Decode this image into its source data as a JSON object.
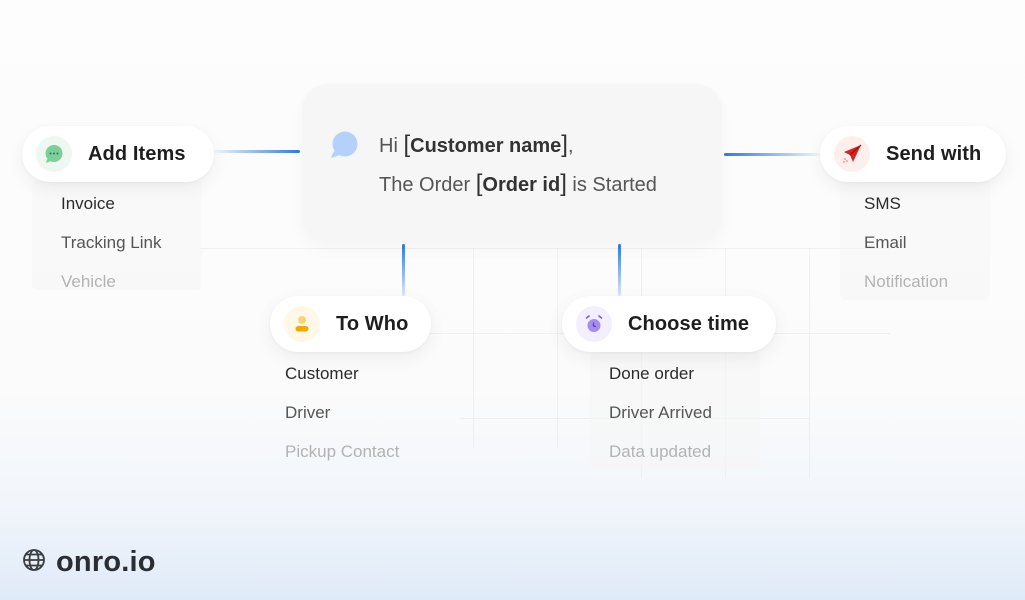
{
  "message": {
    "greeting": "Hi",
    "customer_placeholder": "Customer name",
    "line1_suffix": ",",
    "line2_prefix": "The Order",
    "order_placeholder": "Order id",
    "line2_suffix": "is Started",
    "icon": "chat-bubble-icon"
  },
  "nodes": {
    "add_items": {
      "label": "Add Items",
      "icon": "chat-dots-icon",
      "items": [
        "Invoice",
        "Tracking Link",
        "Vehicle"
      ]
    },
    "to_who": {
      "label": "To Who",
      "icon": "user-icon",
      "items": [
        "Customer",
        "Driver",
        "Pickup Contact"
      ]
    },
    "choose_time": {
      "label": "Choose time",
      "icon": "alarm-clock-icon",
      "items": [
        "Done order",
        "Driver Arrived",
        "Data updated"
      ]
    },
    "send_with": {
      "label": "Send with",
      "icon": "paper-plane-icon",
      "items": [
        "SMS",
        "Email",
        "Notification"
      ]
    }
  },
  "brand": {
    "text": "onro.io",
    "icon": "globe-icon"
  },
  "colors": {
    "connector": "#2d7be0",
    "add_items_icon": "#7ccf97",
    "to_who_icon": "#f2a900",
    "choose_time_icon": "#a58cf0",
    "send_with_icon": "#d62424",
    "bubble": "#b3d1fb"
  }
}
